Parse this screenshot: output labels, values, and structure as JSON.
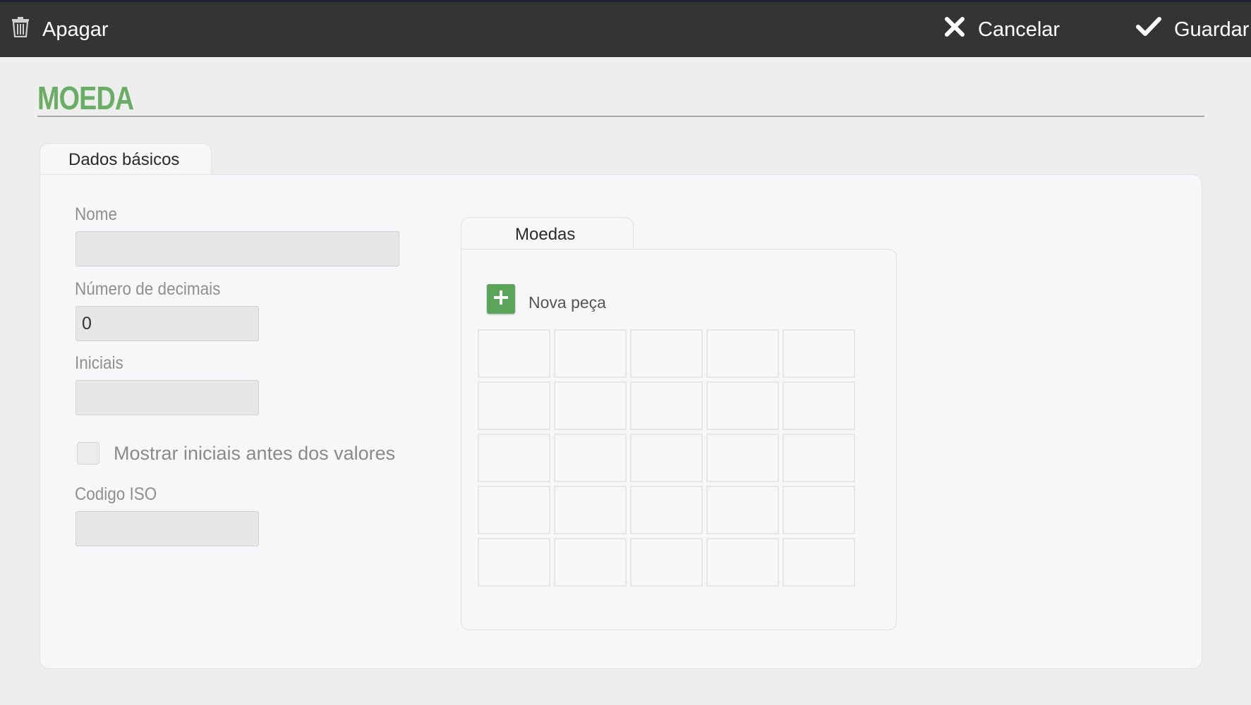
{
  "toolbar": {
    "delete_label": "Apagar",
    "cancel_label": "Cancelar",
    "save_label": "Guardar",
    "delete_icon": "trash-icon",
    "cancel_icon": "close-icon",
    "save_icon": "checkmark-icon"
  },
  "page": {
    "title": "MOEDA",
    "accent_color": "#6aad65"
  },
  "tabs": [
    {
      "label": "Dados básicos",
      "active": true
    }
  ],
  "form": {
    "name": {
      "label": "Nome",
      "value": ""
    },
    "decimals": {
      "label": "Número de decimais",
      "value": "0"
    },
    "initials": {
      "label": "Iniciais",
      "value": ""
    },
    "show_initials": {
      "label": "Mostrar iniciais antes dos valores",
      "checked": false
    },
    "iso_code": {
      "label": "Codigo ISO",
      "value": ""
    }
  },
  "coins": {
    "tab_label": "Moedas",
    "add_label": "Nova peça",
    "add_icon": "plus-icon",
    "rows": 5,
    "columns": 5
  }
}
